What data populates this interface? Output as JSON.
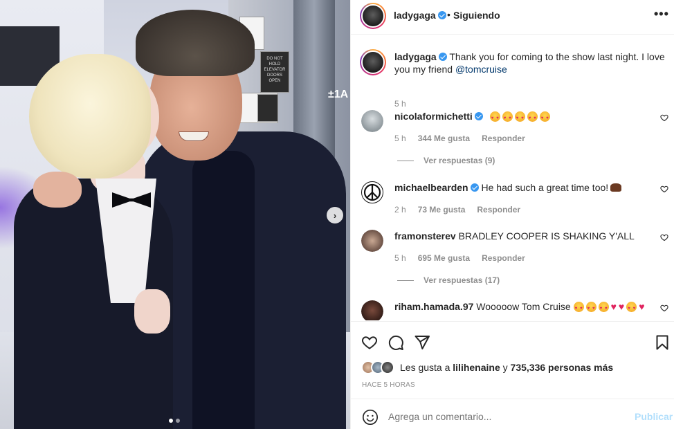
{
  "post": {
    "photo": {
      "poster_text": "DO NOT HOLD ELEVATOR DOORS OPEN",
      "door_sign": "±1A",
      "carousel_next_glyph": "›"
    },
    "header": {
      "username": "ladygaga",
      "separator": "•",
      "follow_status": "Siguiendo",
      "more_glyph": "•••"
    },
    "caption": {
      "username": "ladygaga",
      "text": "Thank you for coming to the show last night. I love you my friend ",
      "mention": "@tomcruise",
      "time": "5 h"
    },
    "comments": [
      {
        "username": "nicolaformichetti",
        "verified": true,
        "text": "",
        "emoji": [
          "heart-eyes-emoji",
          "heart-eyes-emoji",
          "heart-eyes-emoji",
          "heart-eyes-emoji",
          "heart-eyes-emoji"
        ],
        "time": "5 h",
        "likes": "344 Me gusta",
        "reply_label": "Responder",
        "replies": "Ver respuestas (9)"
      },
      {
        "username": "michaelbearden",
        "verified": true,
        "text": "He had such a great time too!",
        "emoji": [
          "raising-hands-emoji"
        ],
        "time": "2 h",
        "likes": "73 Me gusta",
        "reply_label": "Responder"
      },
      {
        "username": "framonsterev",
        "verified": false,
        "text": "BRADLEY COOPER IS SHAKING Y'ALL",
        "time": "5 h",
        "likes": "695 Me gusta",
        "reply_label": "Responder",
        "replies": "Ver respuestas (17)"
      },
      {
        "username": "riham.hamada.97",
        "verified": false,
        "text": "Wooooow Tom Cruise",
        "emoji": [
          "heart-eyes-emoji",
          "heart-eyes-emoji",
          "heart-eyes-emoji",
          "red-heart",
          "red-heart",
          "heart-eyes-emoji",
          "red-heart"
        ]
      }
    ],
    "likes": {
      "prefix": "Les gusta a ",
      "user": "lilihenaine",
      "connector": " y ",
      "count": "735,336 personas más"
    },
    "posted": "HACE 5 HORAS",
    "add_comment": {
      "placeholder": "Agrega un comentario...",
      "post_label": "Publicar"
    },
    "colors": {
      "verified": "#3897f0",
      "mention": "#00376b",
      "publish_disabled": "#b2dffc",
      "meta": "#8e8e8e"
    }
  }
}
